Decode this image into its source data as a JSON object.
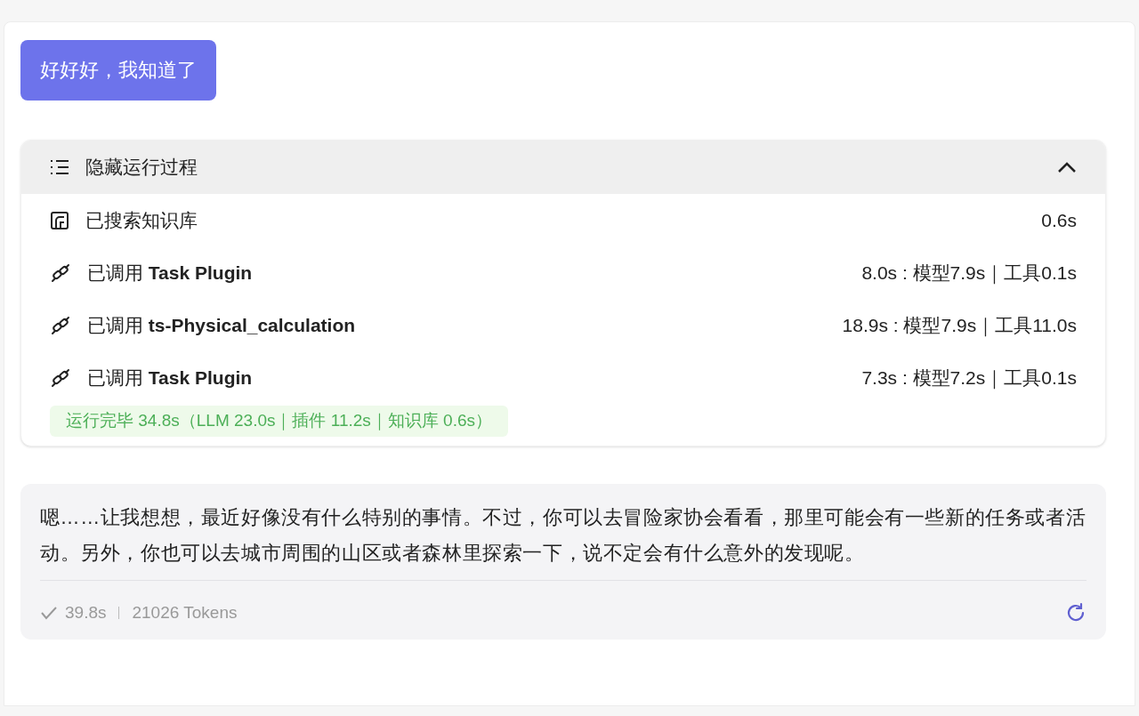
{
  "user_message": "好好好，我知道了",
  "process": {
    "toggle_label": "隐藏运行过程",
    "expanded": true,
    "steps": [
      {
        "kind": "knowledge",
        "label": "已搜索知识库",
        "timing": "0.6s"
      },
      {
        "kind": "plugin",
        "label": "已调用 **Task Plugin**",
        "timing": "8.0s : 模型7.9s｜工具0.1s"
      },
      {
        "kind": "plugin",
        "label": "已调用 **ts-Physical_calculation**",
        "timing": "18.9s : 模型7.9s｜工具11.0s"
      },
      {
        "kind": "plugin",
        "label": "已调用 **Task Plugin**",
        "timing": "7.3s : 模型7.2s｜工具0.1s"
      }
    ],
    "summary": "运行完毕 34.8s（LLM 23.0s｜插件 11.2s｜知识库 0.6s）"
  },
  "answer": {
    "text": "嗯……让我想想，最近好像没有什么特别的事情。不过，你可以去冒险家协会看看，那里可能会有一些新的任务或者活动。另外，你也可以去城市周围的山区或者森林里探索一下，说不定会有什么意外的发现呢。",
    "done": true,
    "duration": "39.8s",
    "tokens": "21026 Tokens"
  }
}
